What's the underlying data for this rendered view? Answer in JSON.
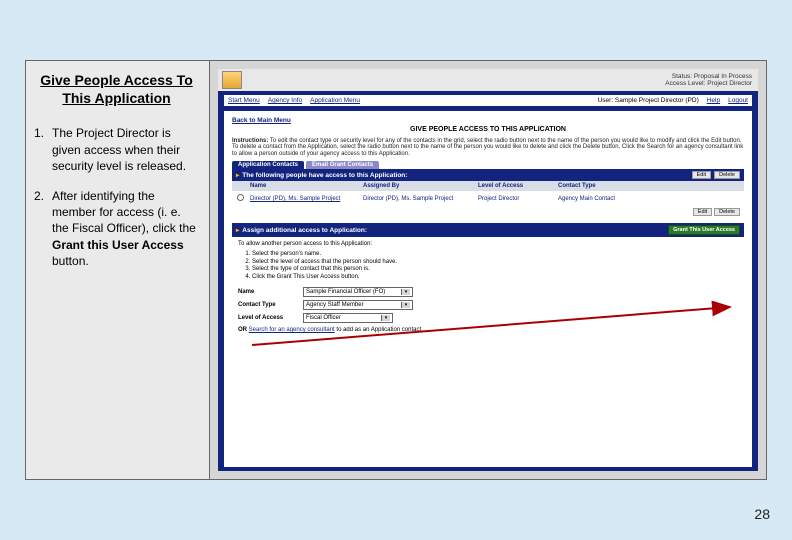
{
  "slide": {
    "title": "Give People Access To This Application",
    "page_number": "28",
    "bullets": [
      {
        "num": "1.",
        "text": "The Project Director is given access when their security level is released."
      },
      {
        "num": "2.",
        "text": "After identifying the member for access (i. e. the Fiscal Officer), click the <b>Grant this User Access</b> button."
      }
    ]
  },
  "app": {
    "status_line1": "Status: Proposal In Process",
    "status_line2": "Access Level: Project Director",
    "menu": {
      "start": "Start Menu",
      "agency": "Agency Info",
      "appmenu": "Application Menu",
      "user": "User: Sample Project Director (PD)",
      "help": "Help",
      "logout": "Logout"
    },
    "back_link": "Back to Main Menu",
    "page_heading": "GIVE PEOPLE ACCESS TO THIS APPLICATION",
    "instructions_label": "Instructions:",
    "instructions": "To edit the contact type or security level for any of the contacts in the grid, select the radio button next to the name of the person you would like to modify and click the Edit button. To delete a contact from the Application, select the radio button next to the name of the person you would like to delete and click the Delete button. Click the Search for an agency consultant link to allow a person outside of your agency access to this Application.",
    "tabs": {
      "contacts": "Application Contacts",
      "email": "Email Grant Contacts"
    },
    "contacts_header": "The following people have access to this Application:",
    "btn_edit": "Edit",
    "btn_delete": "Delete",
    "cols": {
      "name": "Name",
      "assigned": "Assigned By",
      "level": "Level of Access",
      "type": "Contact Type"
    },
    "row": {
      "name": "Director (PD), Ms. Sample Project",
      "assigned": "Director (PD), Ms. Sample Project",
      "level": "Project Director",
      "type": "Agency Main Contact"
    },
    "assign_header": "Assign additional access to Application:",
    "grant_btn": "Grant This User Access",
    "assign_intro": "To allow another person access to this Application:",
    "steps": [
      "Select the person's name.",
      "Select the level of access that the person should have.",
      "Select the type of contact that this person is.",
      "Click the Grant This User Access button."
    ],
    "form": {
      "name_label": "Name",
      "name_value": "Sample Financial Officer (FO)",
      "contact_label": "Contact Type",
      "contact_value": "Agency Staff Member",
      "level_label": "Level of Access",
      "level_value": "Fiscal Officer"
    },
    "or_text": "OR ",
    "or_link": "Search for an agency consultant",
    "or_tail": " to add as an Application contact."
  }
}
